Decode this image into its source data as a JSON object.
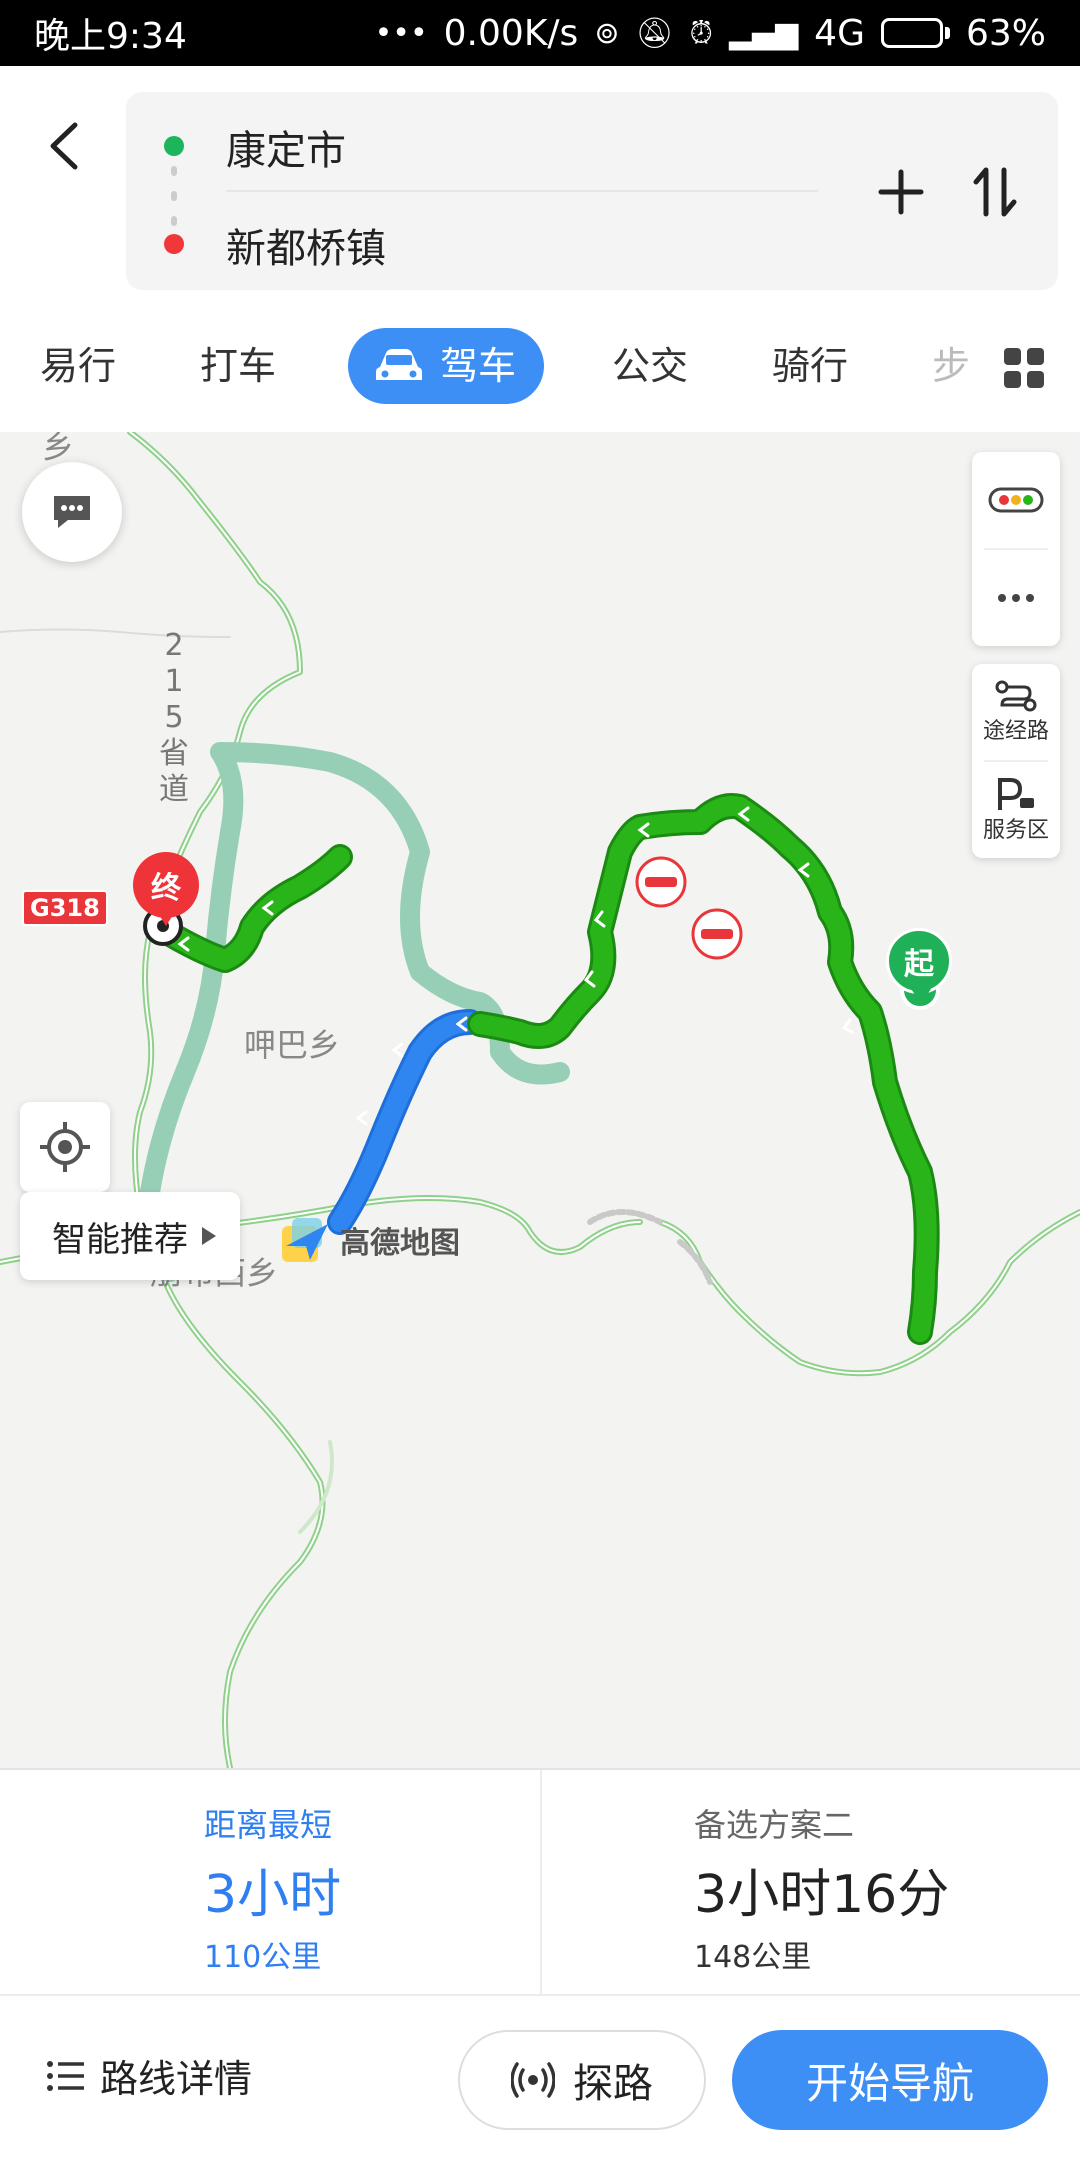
{
  "status_bar": {
    "time": "晚上9:34",
    "speed": "0.00K/s",
    "network": "4G",
    "battery_percent": "63%",
    "battery_level": 0.63
  },
  "route": {
    "from": "康定市",
    "to": "新都桥镇"
  },
  "modes": {
    "items": [
      "易行",
      "打车",
      "驾车",
      "公交",
      "骑行",
      "步"
    ],
    "active": "驾车"
  },
  "map": {
    "labels": {
      "top_town": "乡",
      "jiaba": "呷巴乡",
      "pengbu": "朋布西乡",
      "provincial_road_chars": [
        "2",
        "1",
        "5",
        "省",
        "道"
      ],
      "g318": "G318"
    },
    "side_panel": {
      "waypoint": "途经路",
      "service_area": "服务区"
    },
    "smart_recommend": "智能推荐",
    "logo_text": "高德地图",
    "start_marker": "起",
    "end_marker": "终"
  },
  "plans": [
    {
      "name": "距离最短",
      "time": "3小时",
      "distance": "110公里",
      "selected": true
    },
    {
      "name": "备选方案二",
      "time": "3小时16分",
      "distance": "148公里",
      "selected": false
    }
  ],
  "actions": {
    "details": "路线详情",
    "explore": "探路",
    "start_nav": "开始导航"
  },
  "colors": {
    "accent": "#3d8ff5",
    "route_green": "#29b51a",
    "route_blue": "#2f86f0",
    "alt_route": "#97cfb6",
    "start": "#1fb058",
    "end": "#ee3438"
  }
}
